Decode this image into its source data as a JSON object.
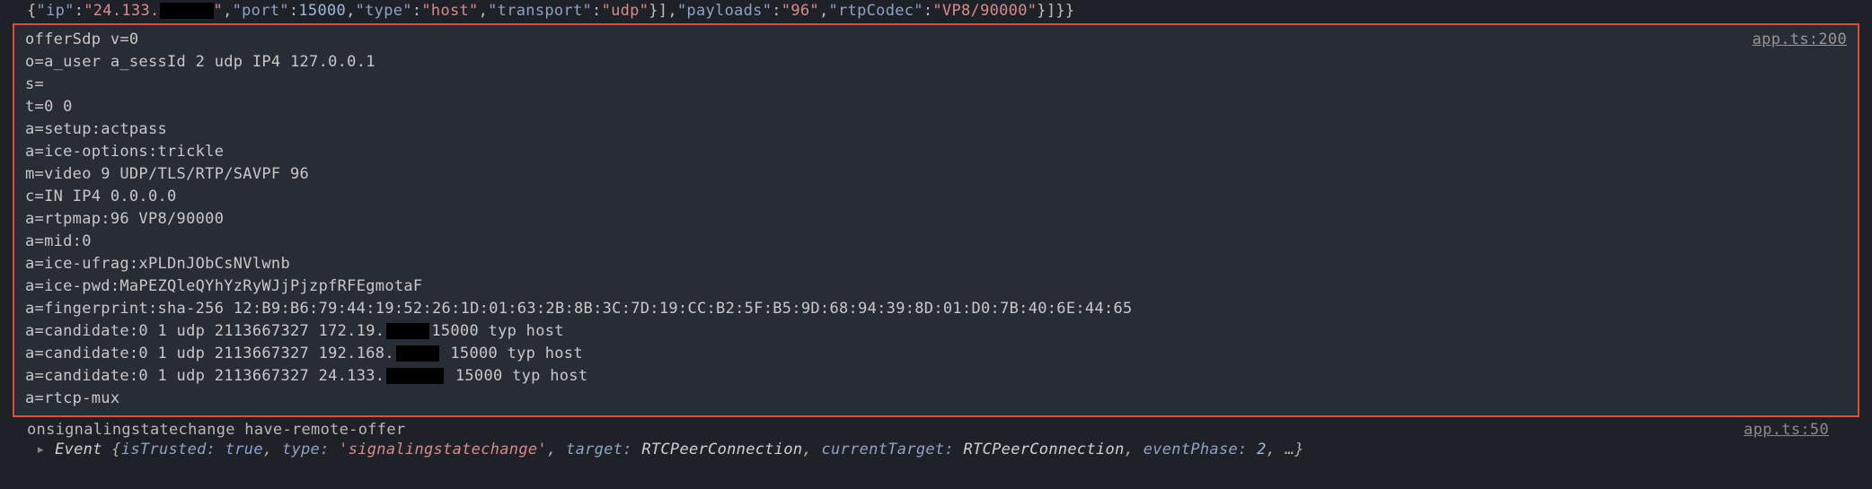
{
  "topJson": {
    "prefix": "{",
    "ip_key": "\"ip\"",
    "ip_val": "\"24.133.",
    "ip_end": "\"",
    "port_key": "\"port\"",
    "port_val": "15000",
    "type_key": "\"type\"",
    "type_val": "\"host\"",
    "transport_key": "\"transport\"",
    "transport_val": "\"udp\"",
    "close1": "}]",
    "payloads_key": "\"payloads\"",
    "payloads_val": "\"96\"",
    "rtpcodec_key": "\"rtpCodec\"",
    "rtpcodec_val": "\"VP8/90000\"",
    "close2": "}]}}"
  },
  "highlight": {
    "source": "app.ts:200",
    "lines": {
      "offerSdp": "offerSdp v=0",
      "o": "o=a_user a_sessId 2 udp IP4 127.0.0.1",
      "s": "s=",
      "t": "t=0 0",
      "setup": "a=setup:actpass",
      "iceopt": "a=ice-options:trickle",
      "m": "m=video 9 UDP/TLS/RTP/SAVPF 96",
      "c": "c=IN IP4 0.0.0.0",
      "rtpmap": "a=rtpmap:96 VP8/90000",
      "mid": "a=mid:0",
      "ufrag": "a=ice-ufrag:xPLDnJObCsNVlwnb",
      "pwd": "a=ice-pwd:MaPEZQleQYhYzRyWJjPjzpfRFEgmotaF",
      "fp": "a=fingerprint:sha-256 12:B9:B6:79:44:19:52:26:1D:01:63:2B:8B:3C:7D:19:CC:B2:5F:B5:9D:68:94:39:8D:01:D0:7B:40:6E:44:65",
      "cand1a": "a=candidate:0 1 udp 2113667327 172.19.",
      "cand1b": "15000 typ host",
      "cand2a": "a=candidate:0 1 udp 2113667327 192.168.",
      "cand2b": " 15000 typ host",
      "cand3a": "a=candidate:0 1 udp 2113667327 24.133.",
      "cand3b": " 15000 typ host",
      "rtcp": "a=rtcp-mux"
    }
  },
  "bottom": {
    "sigline": "onsignalingstatechange have-remote-offer",
    "sigsource": "app.ts:50",
    "event": {
      "arrow": "▸ ",
      "cls": "Event ",
      "brace": "{",
      "isTrusted_k": "isTrusted: ",
      "isTrusted_v": "true",
      "type_k": "type: ",
      "type_v": "'signalingstatechange'",
      "target_k": "target: ",
      "target_v": "RTCPeerConnection",
      "currentTarget_k": "currentTarget: ",
      "currentTarget_v": "RTCPeerConnection",
      "eventPhase_k": "eventPhase: ",
      "eventPhase_v": "2",
      "ellipsis": "…}",
      "comma": ", "
    }
  }
}
